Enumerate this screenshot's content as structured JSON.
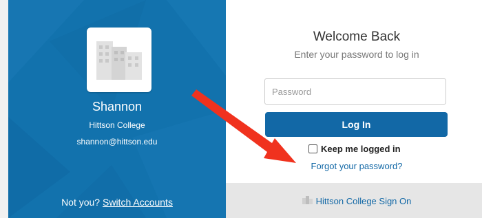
{
  "user": {
    "name": "Shannon",
    "organization": "Hittson College",
    "email": "shannon@hittson.edu"
  },
  "switch": {
    "prompt": "Not you?",
    "link_label": "Switch Accounts"
  },
  "login": {
    "title": "Welcome Back",
    "subtitle": "Enter your password to log in",
    "password_placeholder": "Password",
    "button_label": "Log In",
    "keep_logged_in_label": "Keep me logged in",
    "keep_logged_in_checked": false,
    "forgot_label": "Forgot your password?"
  },
  "sso": {
    "label": "Hittson College Sign On",
    "icon": "building-icon"
  },
  "annotation": {
    "icon": "red-arrow",
    "color": "#f0321e"
  },
  "colors": {
    "left_panel": "#1272ad",
    "accent": "#1268a6",
    "footer": "#e6e6e6"
  }
}
